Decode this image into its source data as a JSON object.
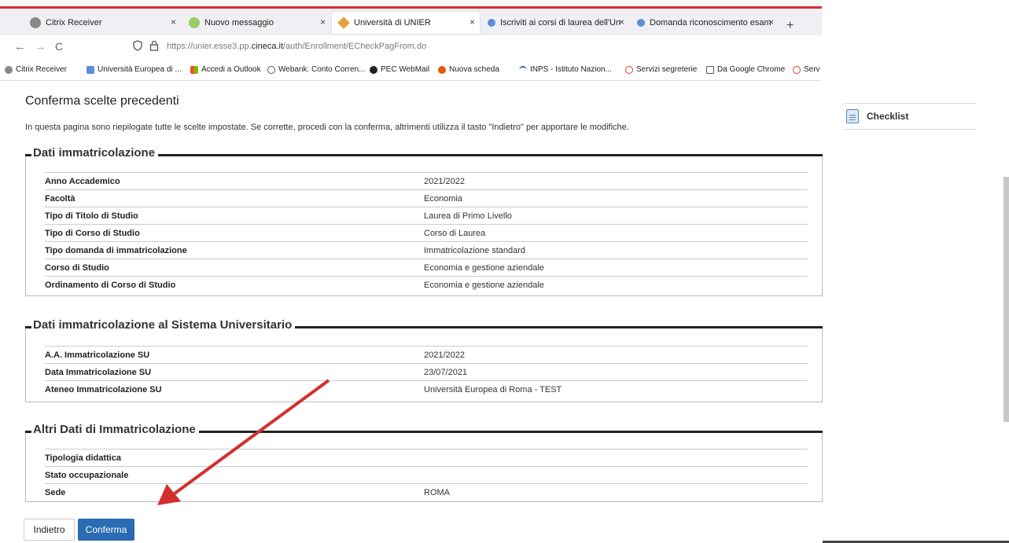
{
  "browser": {
    "tabs": [
      {
        "label": "Citrix Receiver",
        "icon": "citrix-icon",
        "close": "×"
      },
      {
        "label": "Nuovo messaggio",
        "icon": "mail-icon",
        "close": "×"
      },
      {
        "label": "Università di UNIER",
        "icon": "unier-icon",
        "close": "×"
      },
      {
        "label": "Iscriviti ai corsi di laurea dell'Un",
        "icon": "unier-small-icon",
        "close": "×"
      },
      {
        "label": "Domanda riconoscimento esam",
        "icon": "unier-small-icon",
        "close": "×"
      }
    ],
    "new_tab": "+",
    "nav": {
      "back": "←",
      "forward": "→",
      "reload": "C"
    },
    "url": {
      "prefix": "https://unier.esse3.pp.",
      "domain": "cineca.it",
      "suffix": "/auth/Enrollment/ECheckPagFrom.do"
    },
    "bookmarks": [
      {
        "label": "Citrix Receiver",
        "icon": "citrix-icon"
      },
      {
        "label": "Università Europea di ...",
        "icon": "unier-small-icon"
      },
      {
        "label": "Accedi a Outlook",
        "icon": "microsoft-icon"
      },
      {
        "label": "Webank: Conto Corren...",
        "icon": "globe-icon"
      },
      {
        "label": "PEC WebMail",
        "icon": "pec-icon"
      },
      {
        "label": "Nuova scheda",
        "icon": "firefox-icon"
      },
      {
        "label": "INPS - Istituto Nazion...",
        "icon": "inps-icon"
      },
      {
        "label": "Servizi segreterie",
        "icon": "circle-icon"
      },
      {
        "label": "Da Google Chrome",
        "icon": "folder-icon"
      },
      {
        "label": "Serv",
        "icon": "circle-icon"
      }
    ]
  },
  "page": {
    "title": "Conferma scelte precedenti",
    "intro": "In questa pagina sono riepilogate tutte le scelte impostate. Se corrette, procedi con la conferma, altrimenti utilizza il tasto \"Indietro\" per apportare le modifiche.",
    "sections": [
      {
        "title": "Dati immatricolazione",
        "rows": [
          {
            "label": "Anno Accademico",
            "value": "2021/2022"
          },
          {
            "label": "Facoltà",
            "value": "Economia"
          },
          {
            "label": "Tipo di Titolo di Studio",
            "value": "Laurea di Primo Livello"
          },
          {
            "label": "Tipo di Corso di Studio",
            "value": "Corso di Laurea"
          },
          {
            "label": "Tipo domanda di immatricolazione",
            "value": "Immatricolazione standard"
          },
          {
            "label": "Corso di Studio",
            "value": "Economia e gestione aziendale"
          },
          {
            "label": "Ordinamento di Corso di Studio",
            "value": "Economia e gestione aziendale"
          }
        ]
      },
      {
        "title": "Dati immatricolazione al Sistema Universitario",
        "rows": [
          {
            "label": "A.A. Immatricolazione SU",
            "value": "2021/2022"
          },
          {
            "label": "Data Immatricolazione SU",
            "value": "23/07/2021"
          },
          {
            "label": "Ateneo Immatricolazione SU",
            "value": "Università Europea di Roma - TEST"
          }
        ]
      },
      {
        "title": "Altri Dati di Immatricolazione",
        "rows": [
          {
            "label": "Tipologia didattica",
            "value": ""
          },
          {
            "label": "Stato occupazionale",
            "value": ""
          },
          {
            "label": "Sede",
            "value": "ROMA"
          }
        ]
      }
    ],
    "buttons": {
      "back": "Indietro",
      "confirm": "Conferma"
    }
  },
  "sidebar": {
    "checklist": "Checklist"
  },
  "colors": {
    "accent": "#2a6bb1",
    "annotation_arrow": "#d32f2f",
    "browser_top_line": "#d32f2f"
  }
}
